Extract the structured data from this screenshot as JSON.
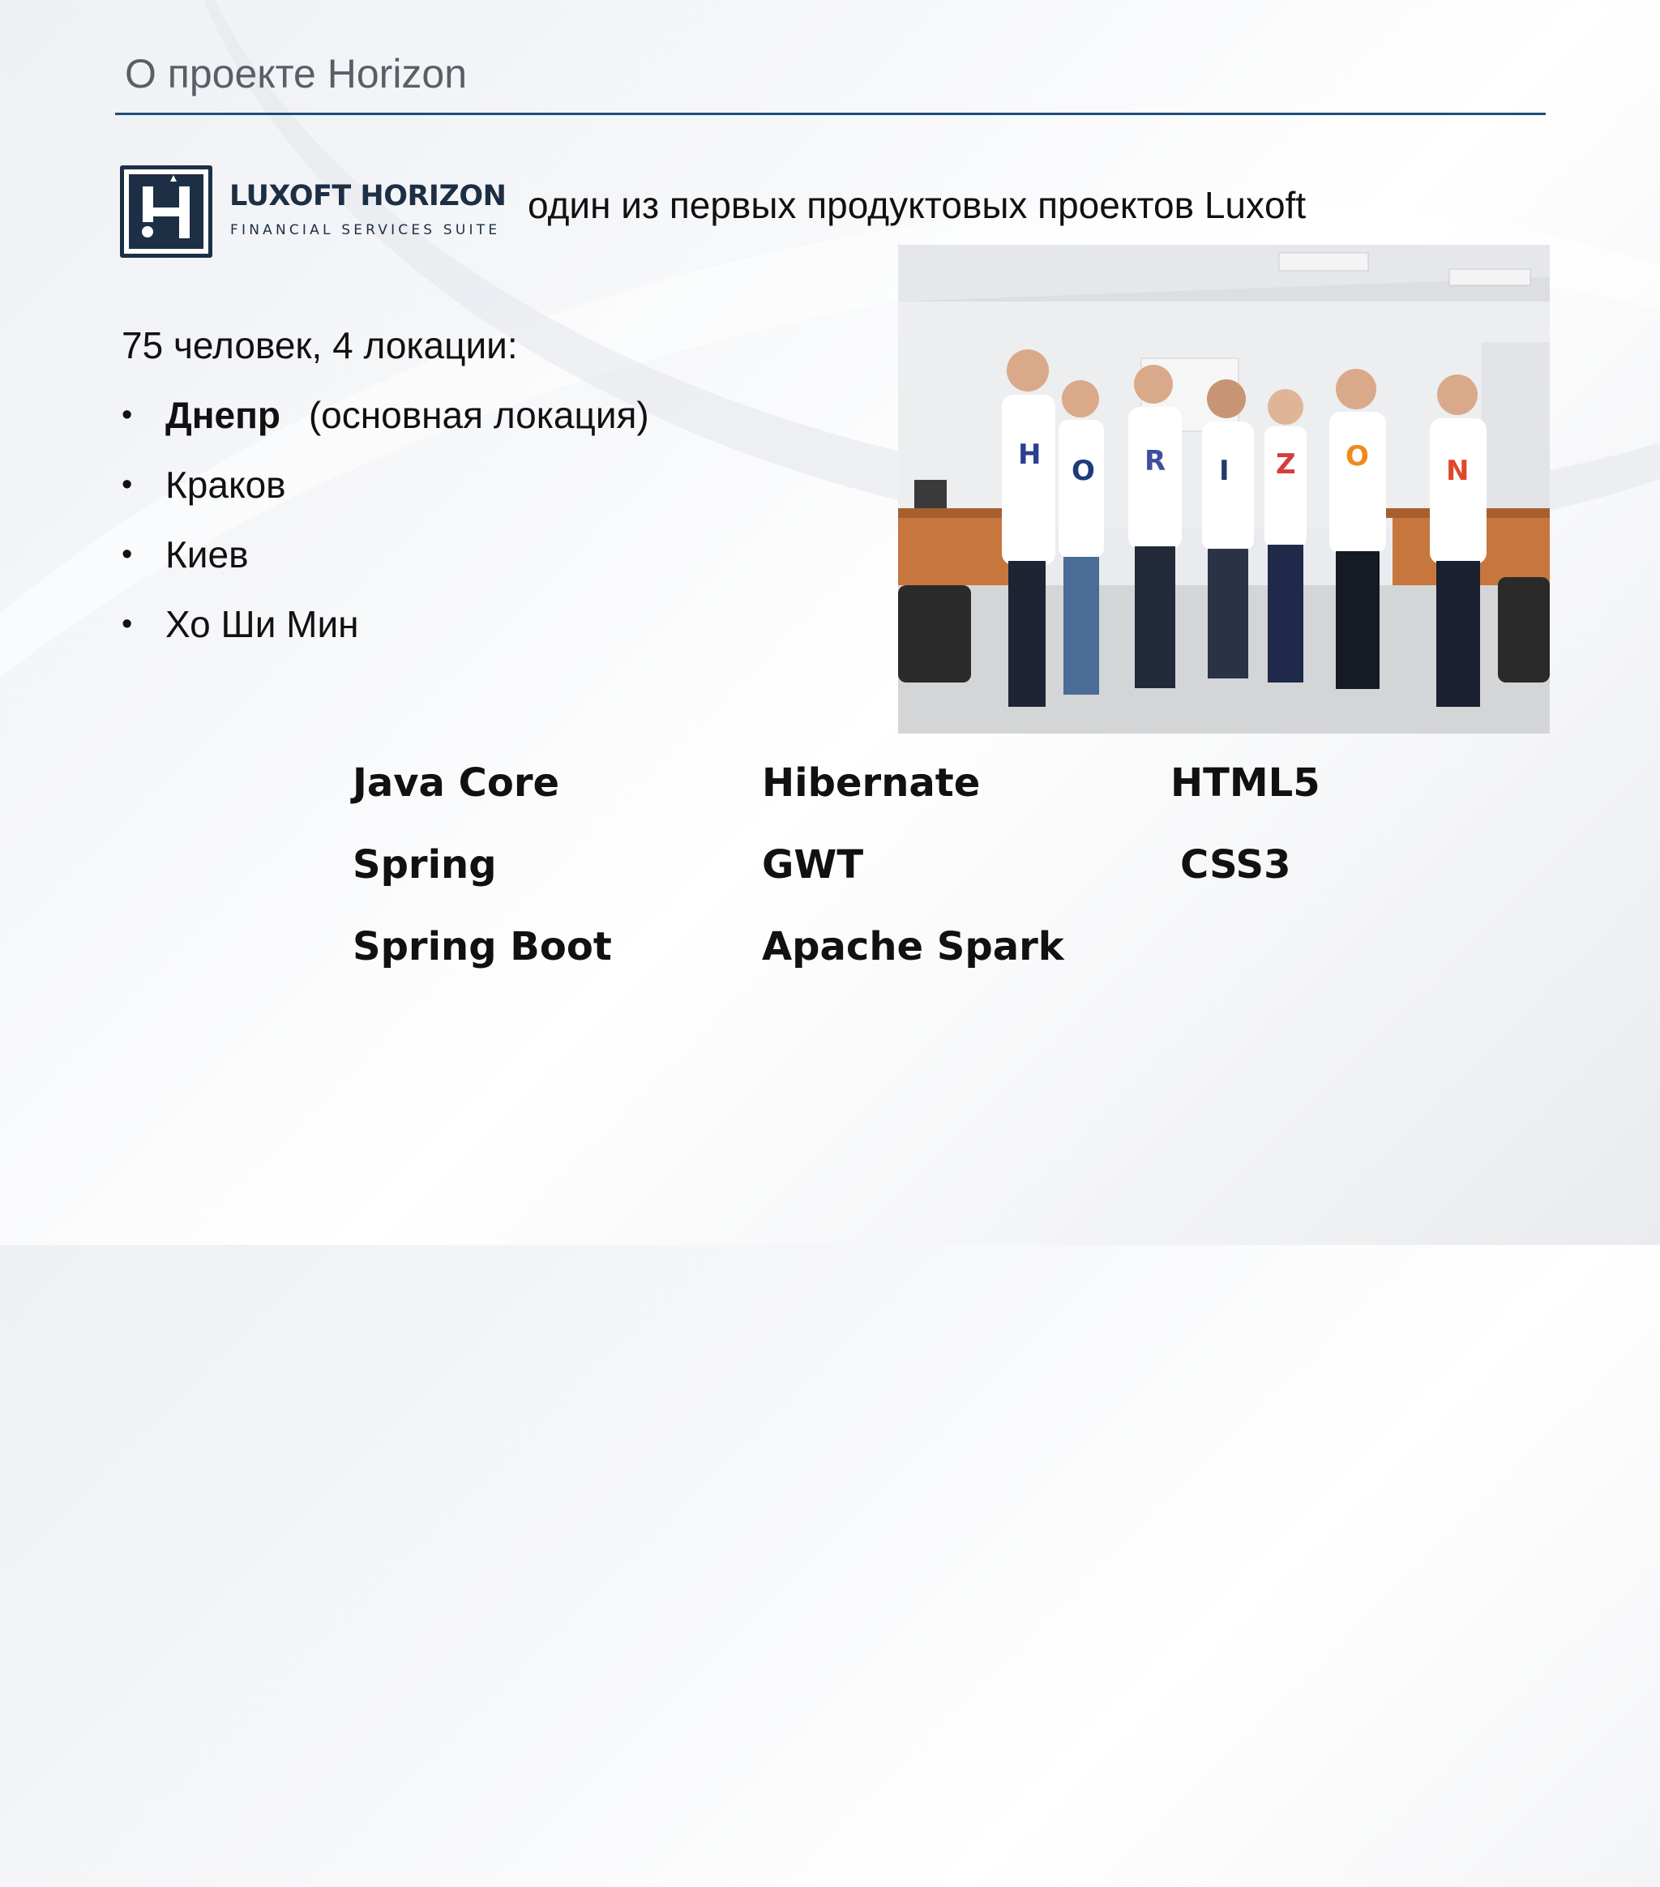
{
  "slide": {
    "title": "О проекте Horizon"
  },
  "logo": {
    "name": "LUXOFT HORIZON",
    "subtitle": "FINANCIAL SERVICES SUITE",
    "brand_color": "#1c2f44"
  },
  "tagline": "один из первых продуктовых проектов Luxoft",
  "team": {
    "summary": "75 человек, 4 локации:",
    "locations": [
      {
        "name": "Днепр",
        "note": "(основная локация)"
      },
      {
        "name": "Краков",
        "note": ""
      },
      {
        "name": "Киев",
        "note": ""
      },
      {
        "name": "Хо Ши Мин",
        "note": ""
      }
    ],
    "bullet": "•"
  },
  "photo": {
    "shirt_letters": [
      "H",
      "O",
      "R",
      "I",
      "Z",
      "O",
      "N"
    ]
  },
  "technologies": {
    "column_1": [
      "Java Core",
      "Spring",
      "Spring Boot"
    ],
    "column_2": [
      "Hibernate",
      "GWT",
      "Apache Spark"
    ],
    "column_3": [
      "HTML5",
      "CSS3"
    ]
  },
  "colors": {
    "title_rule": "#1f4e79",
    "title_text": "#5a5e66"
  }
}
